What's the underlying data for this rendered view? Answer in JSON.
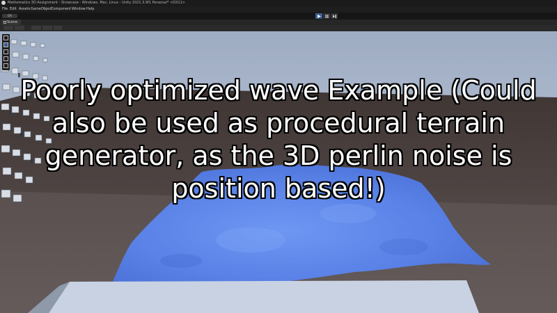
{
  "window": {
    "title": "Mathematics 3D Assignment - Showcase - Windows, Mac, Linux - Unity 2021.3.9f1 Personal* <DX11>"
  },
  "menu": [
    "File",
    "Edit",
    "Assets",
    "GameObject",
    "Component",
    "Window",
    "Help"
  ],
  "toolbar": {
    "account_label": "GA"
  },
  "scene_tab": {
    "label": "Scene"
  },
  "overlay": {
    "line1": "Poorly optimized wave Example (Could",
    "line2": "also be used as procedural terrain",
    "line3": "generator, as the 3D perlin noise is",
    "line4": "position based!)"
  },
  "colors": {
    "water": "#5c83e8",
    "sky": "#b5c1d3",
    "ground": "#4a3e3a",
    "play_active": "#3a5d91"
  }
}
